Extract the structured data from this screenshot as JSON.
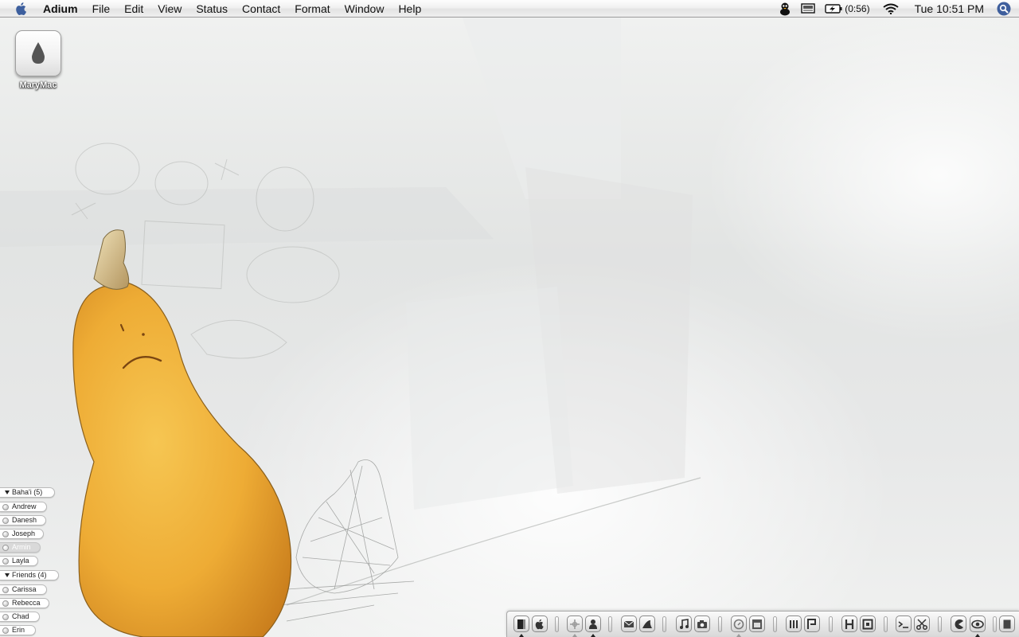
{
  "menubar": {
    "app_name": "Adium",
    "items": [
      "File",
      "Edit",
      "View",
      "Status",
      "Contact",
      "Format",
      "Window",
      "Help"
    ],
    "battery_time": "(0:56)",
    "clock": "Tue 10:51 PM"
  },
  "desktop": {
    "hd_label": "MaryMac"
  },
  "contact_list": {
    "groups": [
      {
        "name": "Baha'i (5)",
        "contacts": [
          {
            "name": "Andrew",
            "idle": false
          },
          {
            "name": "Danesh",
            "idle": false
          },
          {
            "name": "Joseph",
            "idle": false
          },
          {
            "name": "Armin",
            "idle": true
          },
          {
            "name": "Layla",
            "idle": false
          }
        ]
      },
      {
        "name": "Friends (4)",
        "contacts": [
          {
            "name": "Carissa",
            "idle": false
          },
          {
            "name": "Rebecca",
            "idle": false
          },
          {
            "name": "Chad",
            "idle": false
          },
          {
            "name": "Erin",
            "idle": false
          }
        ]
      }
    ]
  },
  "dock": {
    "icons": [
      "finder-icon",
      "apple-icon",
      "network-icon",
      "user-icon",
      "mail-icon",
      "shark-icon",
      "music-icon",
      "camera-icon",
      "safari-icon",
      "calendar-icon",
      "word-icon",
      "pages-icon",
      "hash-icon",
      "preview-icon",
      "terminal-icon",
      "scissors-icon",
      "pacman-icon",
      "eye-icon",
      "trash-icon"
    ]
  },
  "colors": {
    "gourd": "#f2b23a",
    "gourd_shadow": "#d48a1f",
    "menubar": "#efefef"
  }
}
